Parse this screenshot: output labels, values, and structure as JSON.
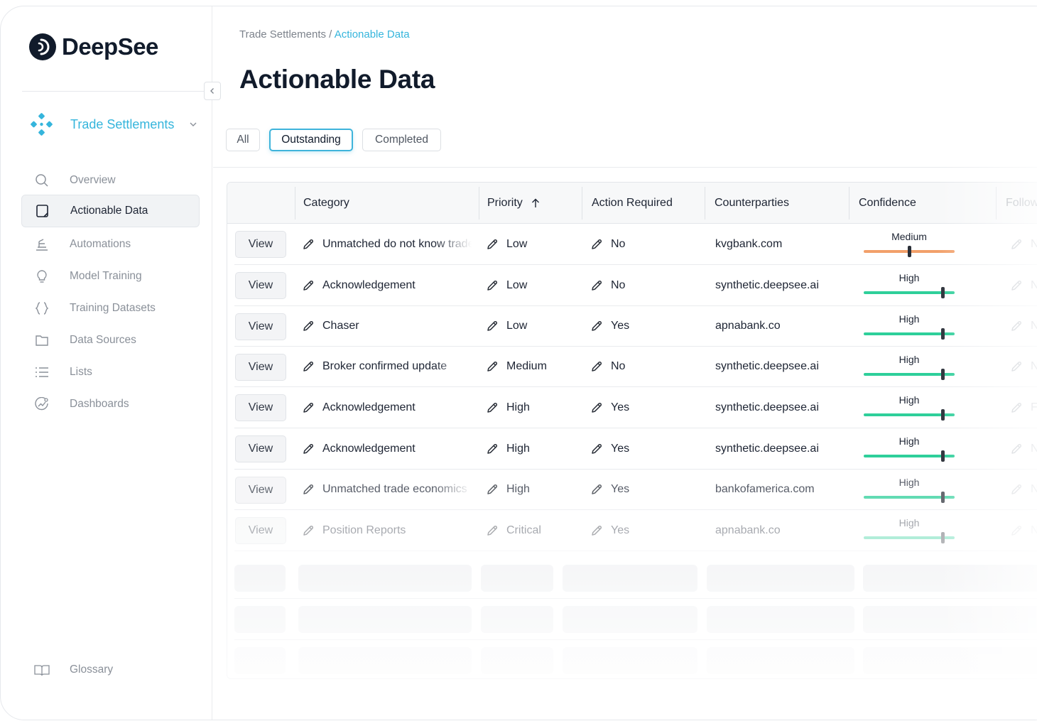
{
  "brand": {
    "name": "DeepSee"
  },
  "sidebar": {
    "workspace": "Trade Settlements",
    "items": [
      {
        "label": "Overview",
        "icon": "search-icon"
      },
      {
        "label": "Actionable Data",
        "icon": "document-icon",
        "active": true
      },
      {
        "label": "Automations",
        "icon": "automation-icon"
      },
      {
        "label": "Model Training",
        "icon": "lightbulb-icon"
      },
      {
        "label": "Training Datasets",
        "icon": "braces-icon"
      },
      {
        "label": "Data Sources",
        "icon": "folder-icon"
      },
      {
        "label": "Lists",
        "icon": "list-icon"
      },
      {
        "label": "Dashboards",
        "icon": "dashboard-icon"
      }
    ],
    "footer": {
      "label": "Glossary",
      "icon": "book-icon"
    }
  },
  "breadcrumb": {
    "parent": "Trade Settlements",
    "separator": " / ",
    "current": "Actionable Data"
  },
  "page": {
    "title": "Actionable Data"
  },
  "filters": [
    "All",
    "Outstanding",
    "Completed"
  ],
  "table": {
    "columns": {
      "category": "Category",
      "priority": "Priority",
      "priority_sort_icon": "arrow-up-icon",
      "action": "Action Required",
      "counterparties": "Counterparties",
      "confidence": "Confidence",
      "follow": "Follow"
    },
    "view_label": "View",
    "rows": [
      {
        "category": "Unmatched do not know trade",
        "priority": "Low",
        "action": "No",
        "counterparty": "kvgbank.com",
        "confidence": "Medium",
        "confidence_level": 0.5,
        "follow": "No"
      },
      {
        "category": "Acknowledgement",
        "priority": "Low",
        "action": "No",
        "counterparty": "synthetic.deepsee.ai",
        "confidence": "High",
        "confidence_level": 0.87,
        "follow": "No"
      },
      {
        "category": "Chaser",
        "priority": "Low",
        "action": "Yes",
        "counterparty": "apnabank.co",
        "confidence": "High",
        "confidence_level": 0.87,
        "follow": "No"
      },
      {
        "category": "Broker confirmed update",
        "priority": "Medium",
        "action": "No",
        "counterparty": "synthetic.deepsee.ai",
        "confidence": "High",
        "confidence_level": 0.87,
        "follow": "No"
      },
      {
        "category": "Acknowledgement",
        "priority": "High",
        "action": "Yes",
        "counterparty": "synthetic.deepsee.ai",
        "confidence": "High",
        "confidence_level": 0.87,
        "follow": "Flag"
      },
      {
        "category": "Acknowledgement",
        "priority": "High",
        "action": "Yes",
        "counterparty": "synthetic.deepsee.ai",
        "confidence": "High",
        "confidence_level": 0.87,
        "follow": "No"
      },
      {
        "category": "Unmatched trade economics",
        "priority": "High",
        "action": "Yes",
        "counterparty": "bankofamerica.com",
        "confidence": "High",
        "confidence_level": 0.87,
        "follow": "No"
      },
      {
        "category": "Position Reports",
        "priority": "Critical",
        "action": "Yes",
        "counterparty": "apnabank.co",
        "confidence": "High",
        "confidence_level": 0.87,
        "follow": "No"
      }
    ]
  },
  "colors": {
    "accent": "#35b5dc",
    "confidence_high": "#2ecf9a",
    "confidence_medium": "#f2a06a"
  }
}
